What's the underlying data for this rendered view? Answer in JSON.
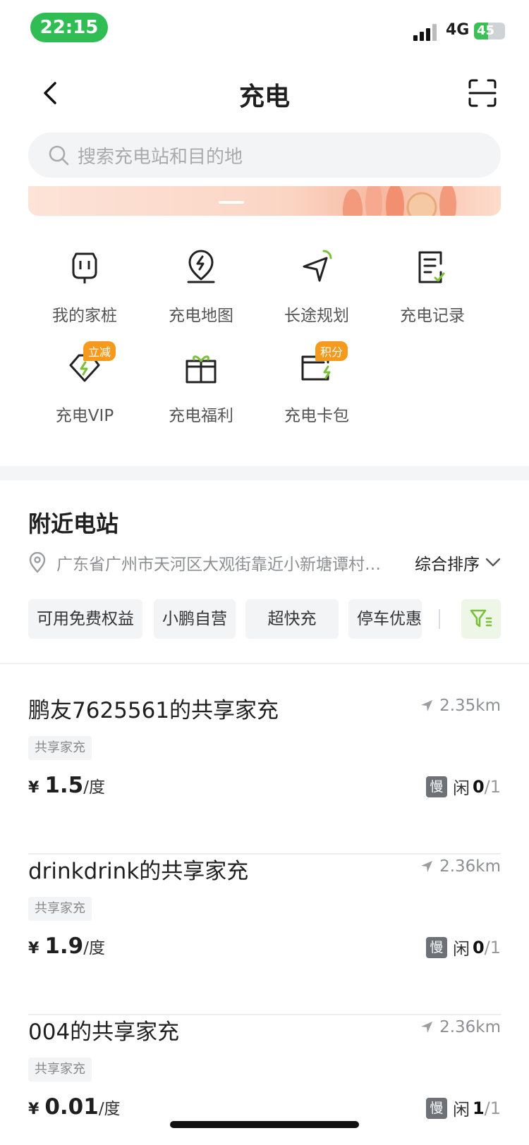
{
  "status_bar": {
    "time": "22:15",
    "network": "4G",
    "battery": "45",
    "battery_level": 0.45
  },
  "header": {
    "title": "充电"
  },
  "search": {
    "placeholder": "搜索充电站和目的地"
  },
  "quick_menu": [
    {
      "label": "我的家桩",
      "icon": "home-charger-icon"
    },
    {
      "label": "充电地图",
      "icon": "charging-map-pin-icon"
    },
    {
      "label": "长途规划",
      "icon": "route-plan-icon"
    },
    {
      "label": "充电记录",
      "icon": "charging-record-icon"
    },
    {
      "label": "充电VIP",
      "icon": "vip-tag-icon",
      "badge": "立减"
    },
    {
      "label": "充电福利",
      "icon": "gift-icon"
    },
    {
      "label": "充电卡包",
      "icon": "card-wallet-icon",
      "badge": "积分"
    }
  ],
  "nearby": {
    "title": "附近电站",
    "location": "广东省广州市天河区大观街靠近小新塘谭村…",
    "sort_label": "综合排序",
    "filters": [
      "可用免费权益",
      "小鹏自营",
      "超快充",
      "停车优惠"
    ]
  },
  "stations": [
    {
      "name": "鹏友7625561的共享家充",
      "distance": "2.35km",
      "tag": "共享家充",
      "currency": "¥",
      "price": "1.5",
      "unit": "/度",
      "speed": "慢",
      "idle_label": "闲",
      "idle": "0",
      "total": "/1"
    },
    {
      "name": "drinkdrink的共享家充",
      "distance": "2.36km",
      "tag": "共享家充",
      "currency": "¥",
      "price": "1.9",
      "unit": "/度",
      "speed": "慢",
      "idle_label": "闲",
      "idle": "0",
      "total": "/1"
    },
    {
      "name": "004的共享家充",
      "distance": "2.36km",
      "tag": "共享家充",
      "currency": "¥",
      "price": "0.01",
      "unit": "/度",
      "speed": "慢",
      "idle_label": "闲",
      "idle": "1",
      "total": "/1"
    }
  ],
  "colors": {
    "accent_green": "#2fbd54",
    "badge_orange": "#f59a1d",
    "filter_green": "#7cbf3a"
  }
}
